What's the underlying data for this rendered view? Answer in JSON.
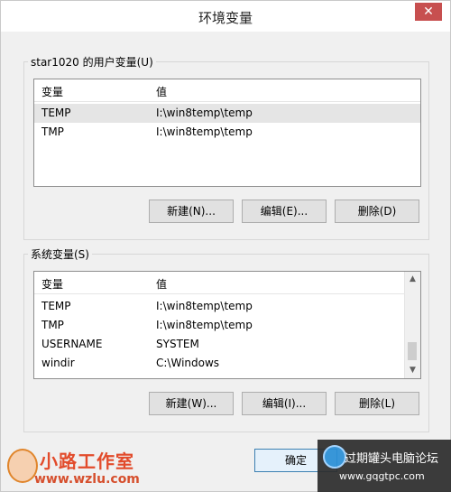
{
  "window": {
    "title": "环境变量",
    "close_glyph": "✕"
  },
  "user_group": {
    "label": "star1020 的用户变量(U)",
    "columns": [
      "变量",
      "值"
    ],
    "rows": [
      {
        "name": "TEMP",
        "value": "I:\\win8temp\\temp"
      },
      {
        "name": "TMP",
        "value": "I:\\win8temp\\temp"
      }
    ],
    "buttons": {
      "new": "新建(N)...",
      "edit": "编辑(E)...",
      "delete": "删除(D)"
    }
  },
  "system_group": {
    "label": "系统变量(S)",
    "columns": [
      "变量",
      "值"
    ],
    "rows": [
      {
        "name": "TEMP",
        "value": "I:\\win8temp\\temp"
      },
      {
        "name": "TMP",
        "value": "I:\\win8temp\\temp"
      },
      {
        "name": "USERNAME",
        "value": "SYSTEM"
      },
      {
        "name": "windir",
        "value": "C:\\Windows"
      }
    ],
    "buttons": {
      "new": "新建(W)...",
      "edit": "编辑(I)...",
      "delete": "删除(L)"
    }
  },
  "footer": {
    "ok": "确定"
  },
  "watermark_left": {
    "title": "小路工作室",
    "url": "www.wzlu.com"
  },
  "watermark_right": {
    "title": "过期罐头电脑论坛",
    "url": "www.gqgtpc.com"
  },
  "icons": {
    "close": "close-icon",
    "scroll_up": "chevron-up-icon",
    "scroll_down": "chevron-down-icon"
  }
}
